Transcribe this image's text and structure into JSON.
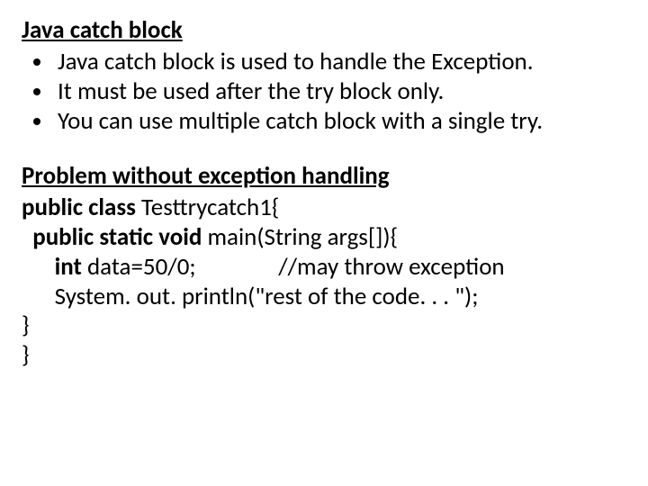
{
  "section1": {
    "title": "Java catch block",
    "bullets": [
      "Java catch block is used to handle the Exception.",
      "It must be used after the try block only.",
      "You can use multiple catch block with a single try."
    ]
  },
  "section2": {
    "title": "Problem without exception handling",
    "code": {
      "l1a": "public class",
      "l1b": " Testtrycatch1{",
      "l2a": "  public static void",
      "l2b": " main(String args[]){",
      "l3a": "      int",
      "l3b": " data=50/0;               //may throw exception",
      "l4": "      System. out. println(\"rest of the code. . . \");",
      "l5": "}",
      "l6": "}"
    }
  }
}
